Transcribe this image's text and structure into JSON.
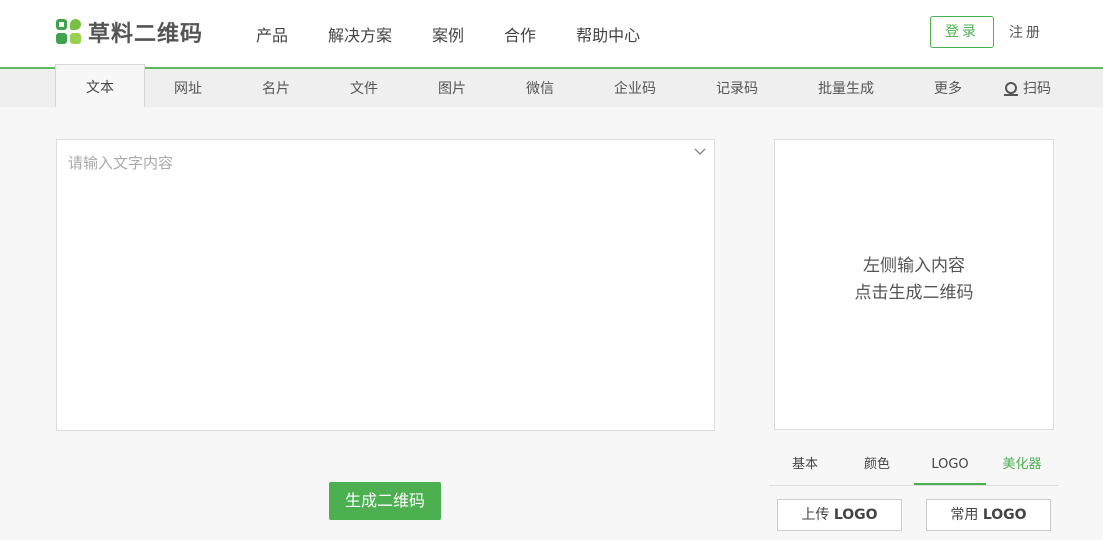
{
  "header": {
    "logo_text": "草料二维码",
    "nav": [
      "产品",
      "解决方案",
      "案例",
      "合作",
      "帮助中心"
    ],
    "login": "登录",
    "register": "注册"
  },
  "tabs": {
    "items": [
      "文本",
      "网址",
      "名片",
      "文件",
      "图片",
      "微信",
      "企业码",
      "记录码",
      "批量生成",
      "更多"
    ],
    "active": "文本",
    "scan": "扫码"
  },
  "editor": {
    "placeholder": "请输入文字内容",
    "value": ""
  },
  "generate_button": "生成二维码",
  "preview": {
    "line1": "左侧输入内容",
    "line2": "点击生成二维码"
  },
  "style_tabs": {
    "items": [
      "基本",
      "颜色",
      "LOGO",
      "美化器"
    ],
    "active": "LOGO",
    "accent": "美化器"
  },
  "logo_buttons": {
    "upload_prefix": "上传",
    "common_prefix": "常用",
    "suffix": "LOGO"
  },
  "colors": {
    "brand_green": "#4caf50",
    "background": "#f7f7f7"
  }
}
